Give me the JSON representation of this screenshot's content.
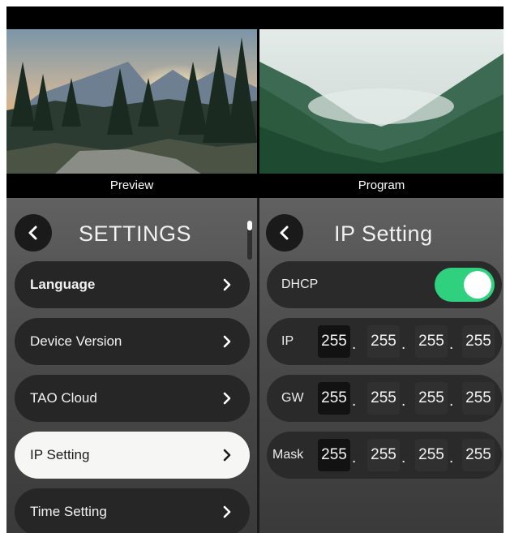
{
  "monitors": {
    "preview_label": "Preview",
    "program_label": "Program"
  },
  "settings_panel": {
    "title": "SETTINGS",
    "menu_items": [
      {
        "label": "Language"
      },
      {
        "label": "Device Version"
      },
      {
        "label": "TAO Cloud"
      },
      {
        "label": "IP Setting"
      },
      {
        "label": "Time Setting"
      }
    ],
    "selected_item": "IP Setting"
  },
  "ip_panel": {
    "title": "IP Setting",
    "dhcp": {
      "label": "DHCP",
      "enabled": true
    },
    "ip": {
      "label": "IP",
      "octets": [
        "255",
        "255",
        "255",
        "255"
      ]
    },
    "gw": {
      "label": "GW",
      "octets": [
        "255",
        "255",
        "255",
        "255"
      ]
    },
    "mask": {
      "label": "Mask",
      "octets": [
        "255",
        "255",
        "255",
        "255"
      ]
    },
    "separator": "."
  },
  "colors": {
    "toggle_on": "#2fd07e",
    "selected_item_bg": "#f6f6f4",
    "item_bg": "#262626"
  },
  "icons": {
    "back": "chevron-left-icon",
    "menu_arrow": "chevron-right-icon"
  }
}
